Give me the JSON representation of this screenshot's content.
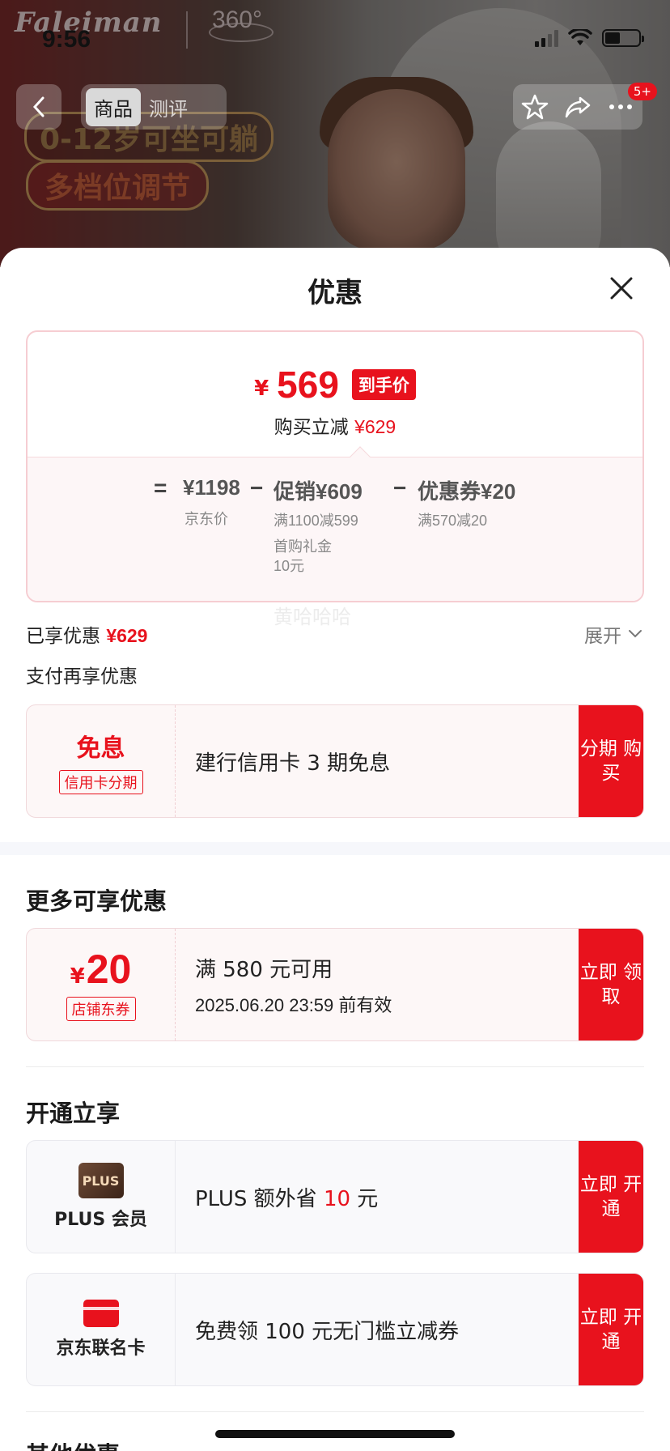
{
  "status_bar": {
    "time": "9:56"
  },
  "banner": {
    "brand": "Faleiman",
    "brand_360": "360°",
    "feature_1": "0-12岁可坐可躺",
    "feature_2": "多档位调节"
  },
  "nav": {
    "tabs": [
      {
        "label": "商品"
      },
      {
        "label": "测评"
      }
    ],
    "badge": "5+"
  },
  "sheet": {
    "title": "优惠",
    "final_price": {
      "currency": "¥",
      "amount": "569",
      "tag": "到手价",
      "reduction_label": "购买立减",
      "reduction_value": "¥629"
    },
    "breakdown": {
      "eq": "=",
      "jd_price": "¥1198",
      "jd_price_label": "京东价",
      "minus1": "−",
      "promo": "促销¥609",
      "promo_note1": "满1100减599",
      "promo_note2": "首购礼金",
      "promo_note3": "10元",
      "minus2": "−",
      "coupon": "优惠券¥20",
      "coupon_note": "满570减20"
    },
    "enjoyed_label": "已享优惠",
    "enjoyed_value": "¥629",
    "expand_label": "展开",
    "pay_more_label": "支付再享优惠",
    "watermark": "黄哈哈哈",
    "installment": {
      "left_title": "免息",
      "left_tag": "信用卡分期",
      "text": "建行信用卡 3 期免息",
      "button": "分期 购买"
    },
    "more_title": "更多可享优惠",
    "store_coupon": {
      "currency": "¥",
      "amount": "20",
      "tag": "店铺东券",
      "condition": "满 580 元可用",
      "expiry": "2025.06.20 23:59 前有效",
      "button": "立即 领取"
    },
    "open_title": "开通立享",
    "plus": {
      "logo": "PLUS",
      "label": "PLUS 会员",
      "text_prefix": "PLUS 额外省 ",
      "text_amount": "10",
      "text_suffix": " 元",
      "button": "立即 开通"
    },
    "jd_card": {
      "label": "京东联名卡",
      "text": "免费领 100 元无门槛立减券",
      "button": "立即 开通"
    },
    "other_title": "其他优惠"
  },
  "colors": {
    "accent": "#e8121d",
    "price_box_border": "#f6cdd2"
  }
}
